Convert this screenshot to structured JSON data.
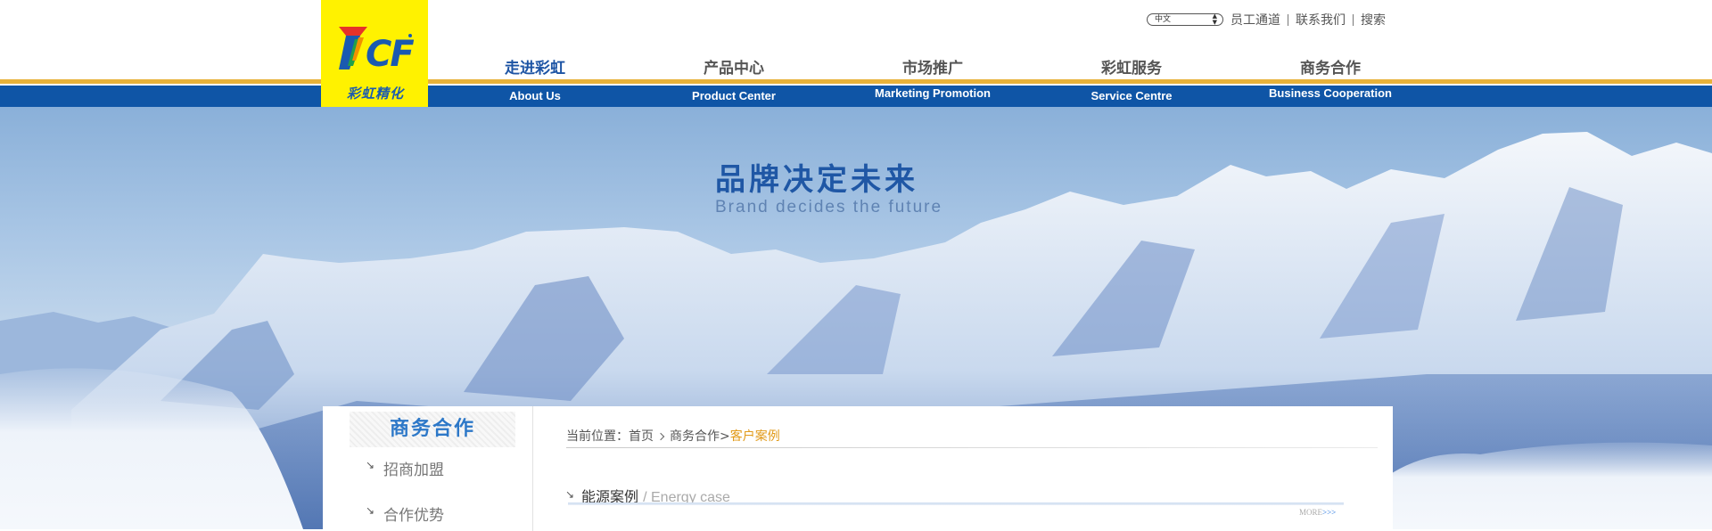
{
  "brand": {
    "logo_text": "彩虹精化",
    "logo_mark": "7CF",
    "colors": {
      "logo_bg": "#fff200",
      "nav_bar": "#0f55a6",
      "gold_line": "#e8b23a",
      "accent": "#1d54a4",
      "highlight": "#e19a19"
    }
  },
  "top_links": {
    "language_select": "中文",
    "items": [
      "员工通道",
      "联系我们",
      "搜索"
    ]
  },
  "nav": {
    "items": [
      {
        "cn": "走进彩虹",
        "en": "About Us"
      },
      {
        "cn": "产品中心",
        "en": "Product Center"
      },
      {
        "cn": "市场推广",
        "en": "Marketing Promotion"
      },
      {
        "cn": "彩虹服务",
        "en": "Service Centre"
      },
      {
        "cn": "商务合作",
        "en": "Business Cooperation"
      }
    ]
  },
  "banner": {
    "slogan_cn": "品牌决定未来",
    "slogan_en": "Brand decides the future"
  },
  "sidebar": {
    "title": "商务合作",
    "items": [
      "招商加盟",
      "合作优势"
    ],
    "arrow_icon": "arrow-down-right-icon"
  },
  "breadcrumb": {
    "label": "当前位置：",
    "home": "首页",
    "section": "商务合作>",
    "current": "客户案例"
  },
  "section": {
    "title_cn": "能源案例",
    "title_en": "/ Energy case",
    "more": "MORE",
    "more_arrows": ">>>"
  }
}
